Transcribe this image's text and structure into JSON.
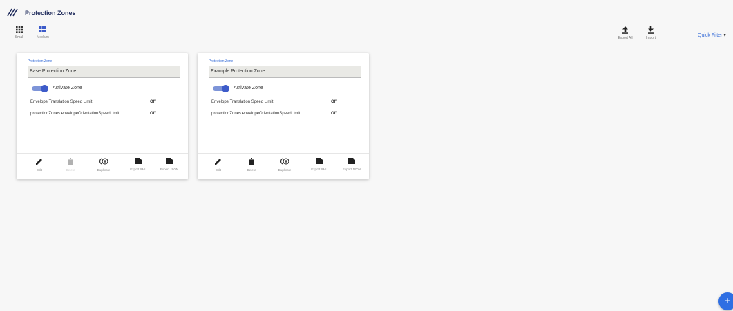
{
  "header": {
    "title": "Protection Zones"
  },
  "view_switch": [
    {
      "label": "Small"
    },
    {
      "label": "Medium"
    }
  ],
  "toolbar": {
    "export_all": "Export All",
    "import": "Import",
    "quick_filter": "Quick Filter"
  },
  "cards": [
    {
      "caption": "Protection Zone",
      "name": "Base Protection Zone",
      "activate_label": "Activate Zone",
      "props": [
        {
          "label": "Envelope Translation Speed Limit",
          "value": "Off"
        },
        {
          "label": "protectionZones.envelopeOrientationSpeedLimit",
          "value": "Off"
        }
      ],
      "actions": [
        "Edit",
        "Delete",
        "Duplicate",
        "Export XML",
        "Export JSON"
      ]
    },
    {
      "caption": "Protection Zone",
      "name": "Example Protection Zone",
      "activate_label": "Activate Zone",
      "props": [
        {
          "label": "Envelope Translation Speed Limit",
          "value": "Off"
        },
        {
          "label": "protectionZones.envelopeOrientationSpeedLimit",
          "value": "Off"
        }
      ],
      "actions": [
        "Edit",
        "Delete",
        "Duplicate",
        "Export XML",
        "Export JSON"
      ]
    }
  ],
  "fab": {
    "symbol": "+"
  },
  "colors": {
    "accent": "#3d5bc9",
    "link": "#3a6fd8",
    "fab": "#2f6fe3"
  }
}
